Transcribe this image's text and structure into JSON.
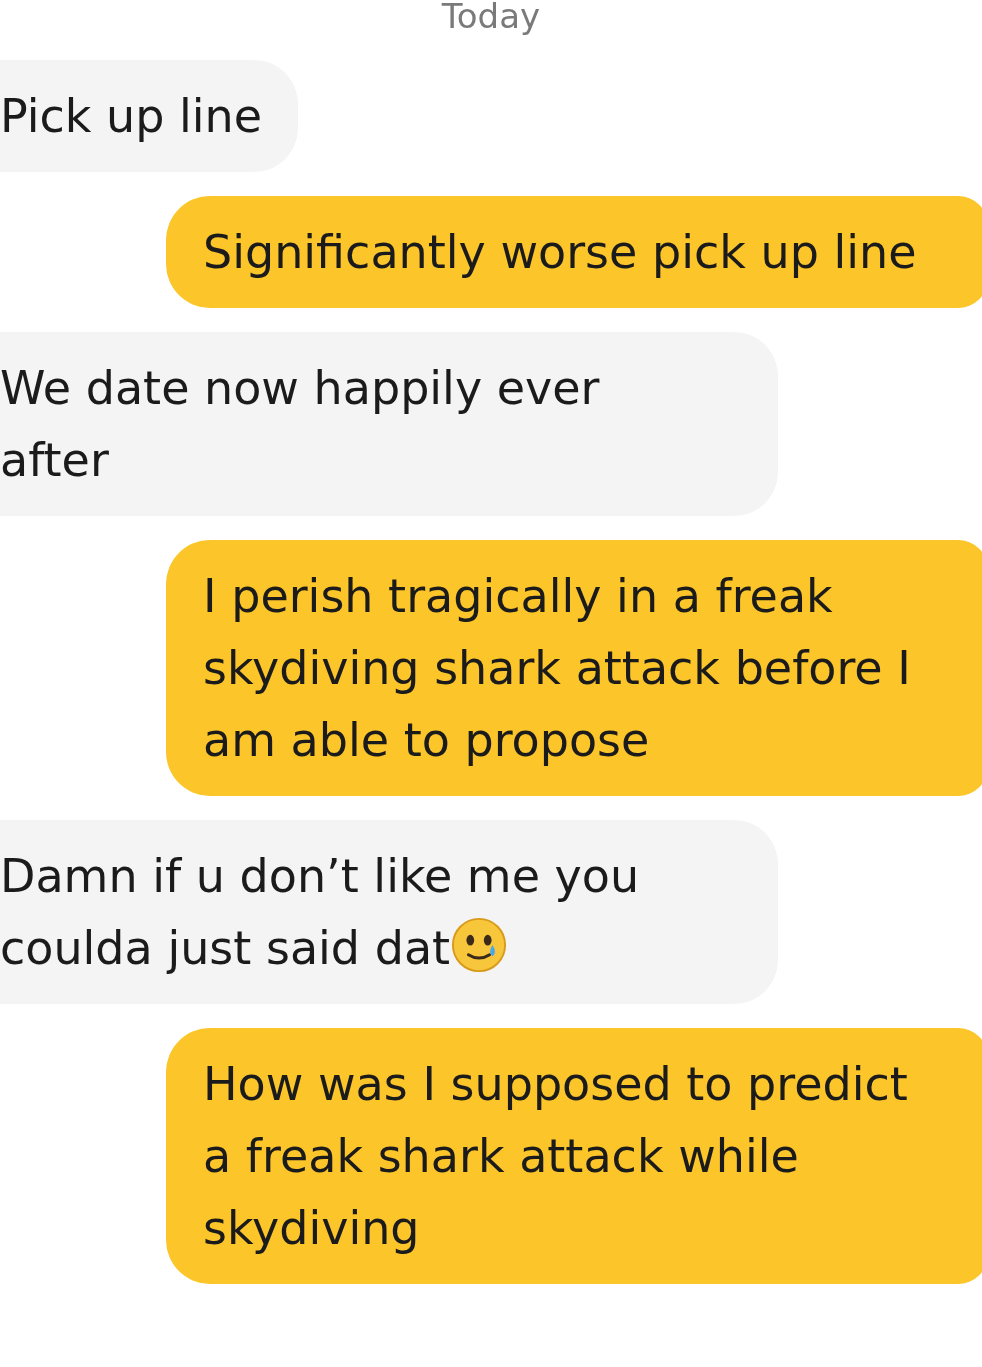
{
  "date_divider": "Today",
  "messages": [
    {
      "kind": "incoming",
      "text": "Pick up line"
    },
    {
      "kind": "outgoing",
      "text": "Significantly worse pick up line"
    },
    {
      "kind": "incoming",
      "text": "We date now happily ever after"
    },
    {
      "kind": "outgoing",
      "text": "I perish tragically in a freak skydiving shark attack before I am able to propose"
    },
    {
      "kind": "incoming",
      "text": "Damn if u don’t like me you coulda just said dat",
      "emoji": true
    },
    {
      "kind": "outgoing",
      "text": "How was I supposed to predict a freak shark attack while skydiving"
    }
  ]
}
